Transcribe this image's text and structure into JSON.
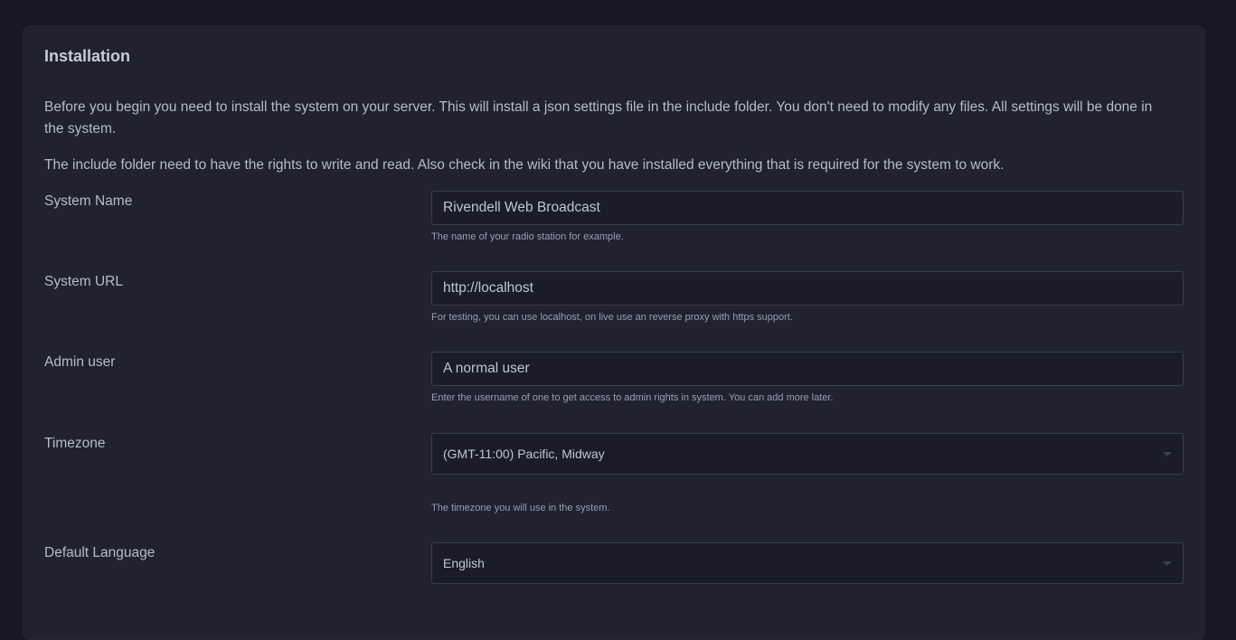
{
  "card": {
    "title": "Installation",
    "intro_1": "Before you begin you need to install the system on your server. This will install a json settings file in the include folder. You don't need to modify any files. All settings will be done in the system.",
    "intro_2": "The include folder need to have the rights to write and read. Also check in the wiki that you have installed everything that is required for the system to work."
  },
  "fields": {
    "system_name": {
      "label": "System Name",
      "value": "Rivendell Web Broadcast",
      "help": "The name of your radio station for example."
    },
    "system_url": {
      "label": "System URL",
      "value": "http://localhost",
      "help": "For testing, you can use localhost, on live use an reverse proxy with https support."
    },
    "admin_user": {
      "label": "Admin user",
      "value": "A normal user",
      "help": "Enter the username of one to get access to admin rights in system. You can add more later."
    },
    "timezone": {
      "label": "Timezone",
      "selected": "(GMT-11:00) Pacific, Midway",
      "help": "The timezone you will use in the system.",
      "icon": "chevron-down-icon"
    },
    "language": {
      "label": "Default Language",
      "selected": "English",
      "icon": "chevron-down-icon"
    }
  },
  "colors": {
    "page_background": "#181824",
    "card_background": "#212130",
    "input_background": "#1c1c29",
    "input_border": "#3a3b4c",
    "text": "#b9bbc9",
    "help_text": "#9c9eae"
  }
}
